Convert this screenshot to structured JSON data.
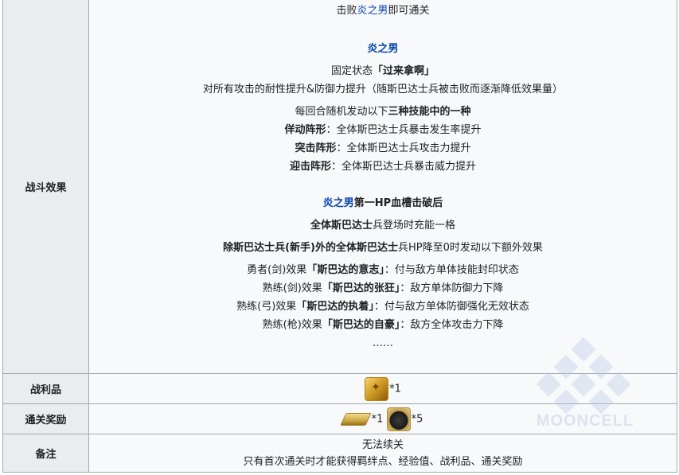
{
  "battle": {
    "label": "战斗效果",
    "intro_pre": "击败",
    "intro_link": "炎之男",
    "intro_post": "即可通关",
    "boss_name": "炎之男",
    "fixed_pre": "固定状态",
    "fixed_name": "「过来拿啊」",
    "fixed_desc": "对所有攻击的耐性提升&防御力提升（随斯巴达士兵被击败而逐渐降低效果量）",
    "random_pre": "每回合随机发动以下",
    "random_bold": "三种技能中的一种",
    "skills": [
      {
        "name": "佯动阵形",
        "desc": "：全体斯巴达士兵暴击发生率提升"
      },
      {
        "name": "突击阵形",
        "desc": "：全体斯巴达士兵攻击力提升"
      },
      {
        "name": "迎击阵形",
        "desc": "：全体斯巴达士兵暴击威力提升"
      }
    ],
    "break_link": "炎之男",
    "break_title": "第一HP血槽击破后",
    "charge_bold": "全体斯巴达士",
    "charge_rest": "兵登场时充能一格",
    "extra_bold": "除斯巴达士兵(新手)外的全体斯巴达士",
    "extra_rest": "兵HP降至0时发动以下额外效果",
    "effects": [
      {
        "pre": "勇者(剑)效果",
        "name": "「斯巴达的意志」",
        "desc": "：付与敌方单体技能封印状态"
      },
      {
        "pre": "熟练(剑)效果",
        "name": "「斯巴达的张狂」",
        "desc": "：敌方单体防御力下降"
      },
      {
        "pre": "熟练(弓)效果",
        "name": "「斯巴达的执着」",
        "desc": "：付与敌方单体防御强化无效状态"
      },
      {
        "pre": "熟练(枪)效果",
        "name": "「斯巴达的自豪」",
        "desc": "：敌方全体攻击力下降"
      }
    ],
    "ellipsis": "……"
  },
  "loot": {
    "label": "战利品",
    "items": [
      {
        "icon": "gold-medal-icon",
        "qty": "*1"
      }
    ]
  },
  "reward": {
    "label": "通关奖励",
    "items": [
      {
        "icon": "gold-ingot-icon",
        "qty": "*1"
      },
      {
        "icon": "dark-pot-icon",
        "qty": "*5"
      }
    ]
  },
  "notes": {
    "label": "备注",
    "line1": "无法续关",
    "line2": "只有首次通关时才能获得羁绊点、经验值、战利品、通关奖励"
  },
  "watermark": {
    "text": "MOONCELL"
  },
  "colors": {
    "link": "#0645ad",
    "label_bg": "#eaecf0",
    "content_bg": "#f8f9fa",
    "border": "#a2a9b1"
  }
}
